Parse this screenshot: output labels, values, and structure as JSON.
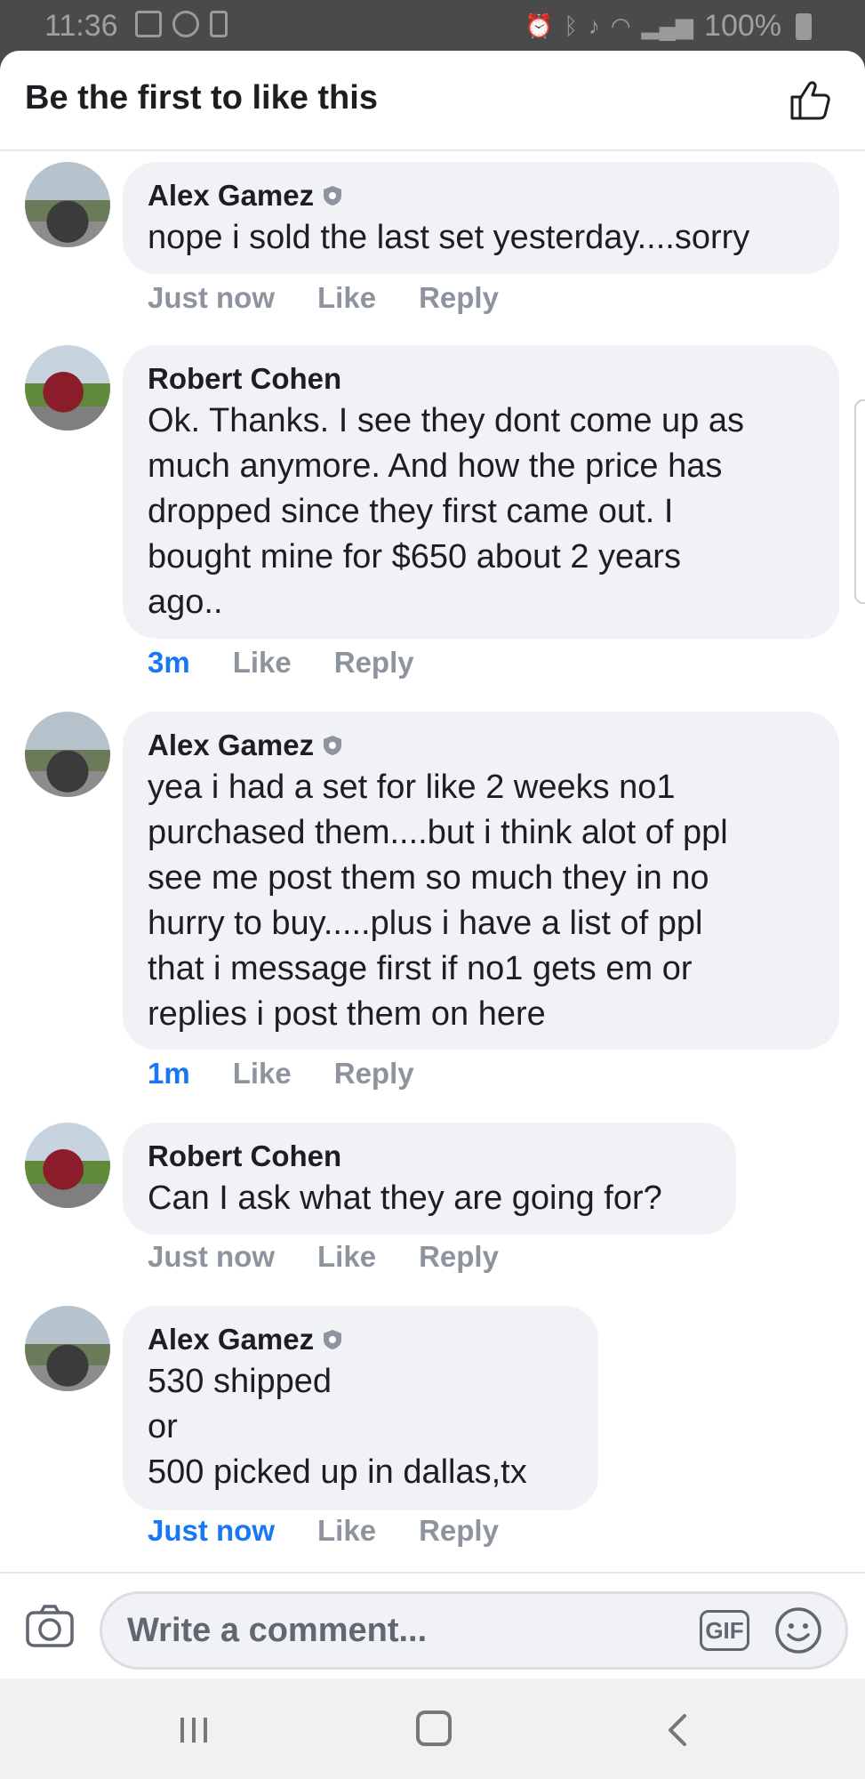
{
  "status_bar": {
    "time": "11:36",
    "battery": "100%"
  },
  "header": {
    "title": "Be the first to like this"
  },
  "comments": [
    {
      "author": "Alex Gamez",
      "text": "nope i sold the last set yesterday....sorry",
      "time": "Just now",
      "like": "Like",
      "reply": "Reply"
    },
    {
      "author": "Robert Cohen",
      "text": "Ok. Thanks. I see they dont come up as\nmuch anymore. And how the price has\ndropped since they first came out. I\nbought mine for $650 about 2 years\nago..",
      "time": "3m",
      "like": "Like",
      "reply": "Reply"
    },
    {
      "author": "Alex Gamez",
      "text": "yea i had a set for like 2 weeks no1\npurchased them....but i think alot of ppl\nsee me post them so much they in no\nhurry to buy.....plus i have a list of ppl\nthat i message first if no1 gets em or\nreplies i post them on here",
      "time": "1m",
      "like": "Like",
      "reply": "Reply"
    },
    {
      "author": "Robert Cohen",
      "text": "Can I ask what they are going for?",
      "time": "Just now",
      "like": "Like",
      "reply": "Reply"
    },
    {
      "author": "Alex Gamez",
      "text": "530 shipped\nor\n500 picked up in dallas,tx",
      "time": "Just now",
      "like": "Like",
      "reply": "Reply"
    }
  ],
  "composer": {
    "placeholder": "Write a comment...",
    "gif_label": "GIF"
  },
  "icons": {
    "header_like": "thumbs-up-icon",
    "camera": "camera-icon",
    "emoji": "smile-icon",
    "verified": "shield-badge-icon"
  }
}
